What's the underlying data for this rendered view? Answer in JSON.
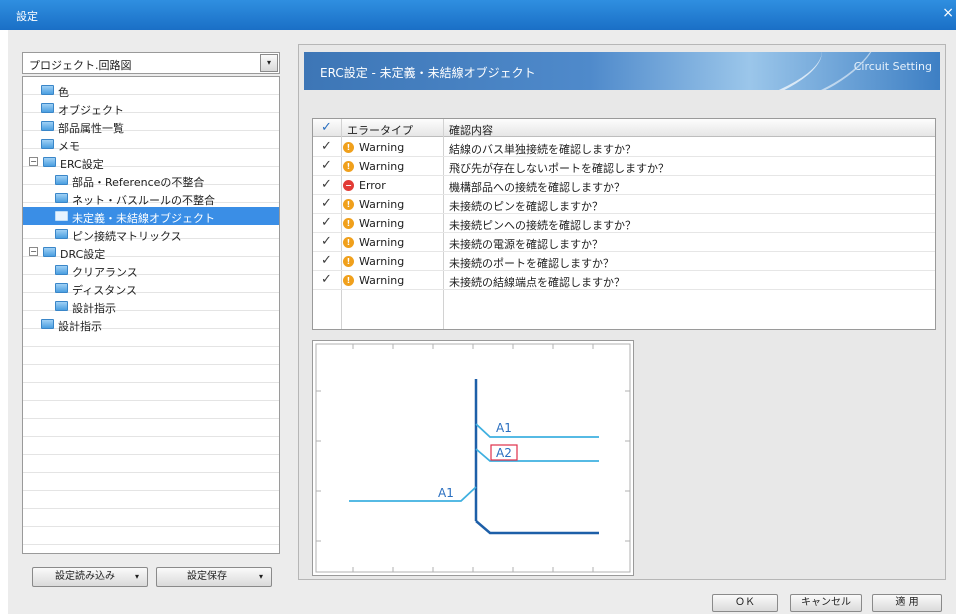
{
  "window": {
    "title": "設定",
    "close_glyph": "×"
  },
  "sidebar": {
    "combo_value": "プロジェクト.回路図",
    "combo_arrow": "▾",
    "tree": [
      {
        "label": "色",
        "level": 1,
        "expander": ""
      },
      {
        "label": "オブジェクト",
        "level": 1,
        "expander": ""
      },
      {
        "label": "部品属性一覧",
        "level": 1,
        "expander": ""
      },
      {
        "label": "メモ",
        "level": 1,
        "expander": ""
      },
      {
        "label": "ERC設定",
        "level": 0,
        "expander": "−"
      },
      {
        "label": "部品・Referenceの不整合",
        "level": 2,
        "expander": ""
      },
      {
        "label": "ネット・バスルールの不整合",
        "level": 2,
        "expander": ""
      },
      {
        "label": "未定義・未結線オブジェクト",
        "level": 2,
        "expander": "",
        "selected": true
      },
      {
        "label": "ピン接続マトリックス",
        "level": 2,
        "expander": ""
      },
      {
        "label": "DRC設定",
        "level": 0,
        "expander": "−"
      },
      {
        "label": "クリアランス",
        "level": 2,
        "expander": ""
      },
      {
        "label": "ディスタンス",
        "level": 2,
        "expander": ""
      },
      {
        "label": "設計指示",
        "level": 2,
        "expander": ""
      },
      {
        "label": "設計指示",
        "level": 1,
        "expander": ""
      }
    ],
    "load_button": "設定読み込み",
    "save_button": "設定保存",
    "button_arrow": "▾"
  },
  "banner": {
    "title": "ERC設定 - 未定義・未結線オブジェクト",
    "subtitle": "Circuit Setting"
  },
  "grid": {
    "headers": {
      "check": "✓",
      "type": "エラータイプ",
      "content": "確認内容"
    },
    "check_glyph": "✓",
    "rows": [
      {
        "type": "Warning",
        "severity": "warning",
        "badge": "!",
        "content": "結線のバス単独接続を確認しますか？"
      },
      {
        "type": "Warning",
        "severity": "warning",
        "badge": "!",
        "content": "飛び先が存在しないポートを確認しますか？"
      },
      {
        "type": "Error",
        "severity": "error",
        "badge": "−",
        "content": "機構部品への接続を確認しますか？"
      },
      {
        "type": "Warning",
        "severity": "warning",
        "badge": "!",
        "content": "未接続のピンを確認しますか？"
      },
      {
        "type": "Warning",
        "severity": "warning",
        "badge": "!",
        "content": "未接続ピンへの接続を確認しますか？"
      },
      {
        "type": "Warning",
        "severity": "warning",
        "badge": "!",
        "content": "未接続の電源を確認しますか？"
      },
      {
        "type": "Warning",
        "severity": "warning",
        "badge": "!",
        "content": "未接続のポートを確認しますか？"
      },
      {
        "type": "Warning",
        "severity": "warning",
        "badge": "!",
        "content": "未接続の結線端点を確認しますか？"
      }
    ]
  },
  "preview": {
    "labels": {
      "a1_top": "A1",
      "a2": "A2",
      "a1_left": "A1"
    },
    "colors": {
      "bus": "#1d5fa8",
      "wire": "#3fb0e0",
      "label": "#2a6fc0",
      "highlight": "#e0304a"
    }
  },
  "footer": {
    "ok": "ＯＫ",
    "cancel": "キャンセル",
    "apply": "適 用"
  },
  "colors": {
    "titlebar": "#1a6fc6",
    "selection": "#3a8ee6",
    "warning": "#f0a01c",
    "error": "#e23b35"
  }
}
